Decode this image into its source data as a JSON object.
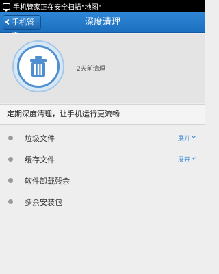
{
  "status_bar": {
    "text": "手机管家正在安全扫描\"地图\""
  },
  "title_bar": {
    "back_label": "手机管家",
    "title": "深度清理"
  },
  "header": {
    "last_cleaned": "2天前清理",
    "icon": "trash-can-icon",
    "accent_color": "#4f8fd0"
  },
  "description": "定期深度清理，让手机运行更流畅",
  "items": [
    {
      "label": "垃圾文件",
      "expand": "展开"
    },
    {
      "label": "缓存文件",
      "expand": "展开"
    },
    {
      "label": "软件卸载残余"
    },
    {
      "label": "多余安装包"
    }
  ]
}
